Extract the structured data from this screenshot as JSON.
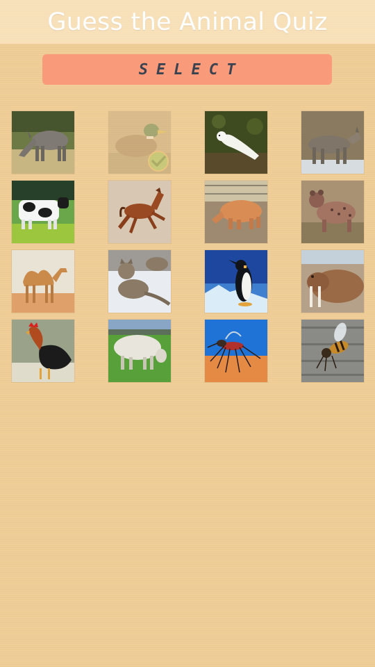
{
  "header": {
    "title": "Guess the Animal Quiz"
  },
  "select_button": {
    "label": "SELECT"
  },
  "colors": {
    "background": "#eecb93",
    "header_overlay": "#fff0d7",
    "select_button": "#f99a7b",
    "select_text": "#3b4350",
    "check_badge": "#8bc34a"
  },
  "grid": {
    "animals": [
      {
        "name": "donkey",
        "state": "unsolved"
      },
      {
        "name": "duck",
        "state": "solved"
      },
      {
        "name": "weasel",
        "state": "unsolved"
      },
      {
        "name": "coyote",
        "state": "unsolved"
      },
      {
        "name": "cow",
        "state": "unsolved"
      },
      {
        "name": "horse",
        "state": "unsolved"
      },
      {
        "name": "pig",
        "state": "unsolved"
      },
      {
        "name": "hyena",
        "state": "unsolved"
      },
      {
        "name": "camel",
        "state": "unsolved"
      },
      {
        "name": "cougar",
        "state": "unsolved"
      },
      {
        "name": "penguin",
        "state": "unsolved"
      },
      {
        "name": "walrus",
        "state": "unsolved"
      },
      {
        "name": "rooster",
        "state": "unsolved"
      },
      {
        "name": "sheep",
        "state": "unsolved"
      },
      {
        "name": "mosquito",
        "state": "unsolved"
      },
      {
        "name": "bee",
        "state": "unsolved"
      }
    ]
  }
}
